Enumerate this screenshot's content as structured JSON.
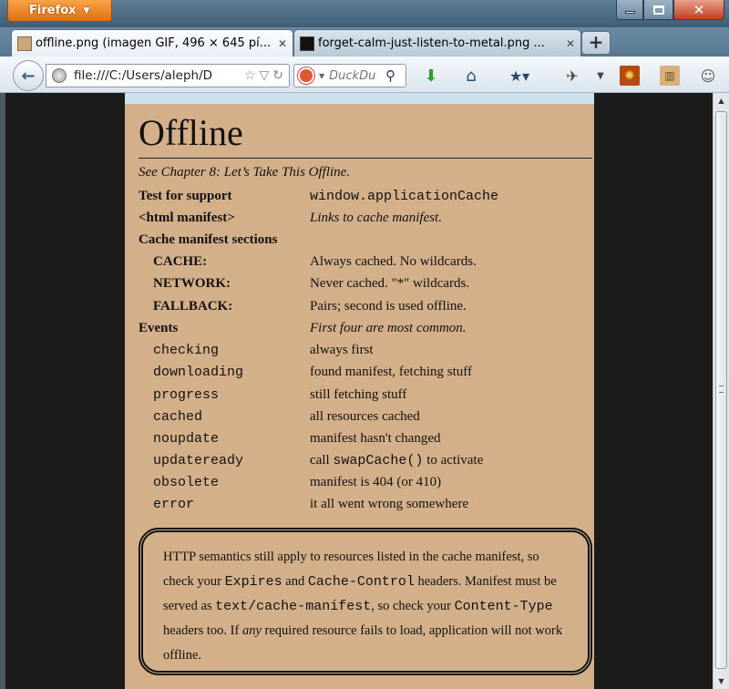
{
  "titlebar": {
    "app_button_label": "Firefox",
    "min_label": "",
    "max_label": "",
    "close_label": "✕"
  },
  "tabs": [
    {
      "label": "offline.png (imagen GIF, 496 × 645 pí...",
      "close": "✕"
    },
    {
      "label": "forget-calm-just-listen-to-metal.png ...",
      "close": "✕"
    }
  ],
  "new_tab_label": "+",
  "navbar": {
    "url": "file:///C:/Users/aleph/D",
    "search_placeholder": "DuckDu",
    "back_icon": "back-arrow-icon"
  },
  "card": {
    "heading": "Offline",
    "subtitle": "See Chapter 8: Let’s Take This Offline.",
    "rows": [
      {
        "key": "Test for support",
        "value": "window.applicationCache"
      },
      {
        "key": "<html manifest>",
        "value": "Links to cache manifest."
      },
      {
        "key": "Cache manifest sections",
        "value": ""
      },
      {
        "key": "CACHE:",
        "value": "Always cached. No wildcards."
      },
      {
        "key": "NETWORK:",
        "value": "Never cached. \"*\" wildcards."
      },
      {
        "key": "FALLBACK:",
        "value": "Pairs; second is used offline."
      },
      {
        "key": "Events",
        "value": "First four are most common."
      },
      {
        "key": "checking",
        "value": "always first"
      },
      {
        "key": "downloading",
        "value": "found manifest, fetching stuff"
      },
      {
        "key": "progress",
        "value": "still fetching stuff"
      },
      {
        "key": "cached",
        "value": "all resources cached"
      },
      {
        "key": "noupdate",
        "value": "manifest hasn't changed"
      },
      {
        "key": "updateready",
        "value_pre": "call ",
        "value_code": "swapCache()",
        "value_post": " to activate"
      },
      {
        "key": "obsolete",
        "value": "manifest is 404 (or 410)"
      },
      {
        "key": "error",
        "value": "it all went wrong somewhere"
      }
    ],
    "note": {
      "t1": "HTTP semantics still apply to resources listed in the cache manifest, so check your ",
      "c1": "Expires",
      "t2": " and ",
      "c2": "Cache-Control",
      "t3": " headers. Manifest must be served as ",
      "c3": "text/cache-manifest",
      "t4": ", so check your ",
      "c4": "Content-Type",
      "t5": " headers too. If ",
      "em": "any",
      "t6": " required resource fails to load, application will not work offline."
    }
  }
}
